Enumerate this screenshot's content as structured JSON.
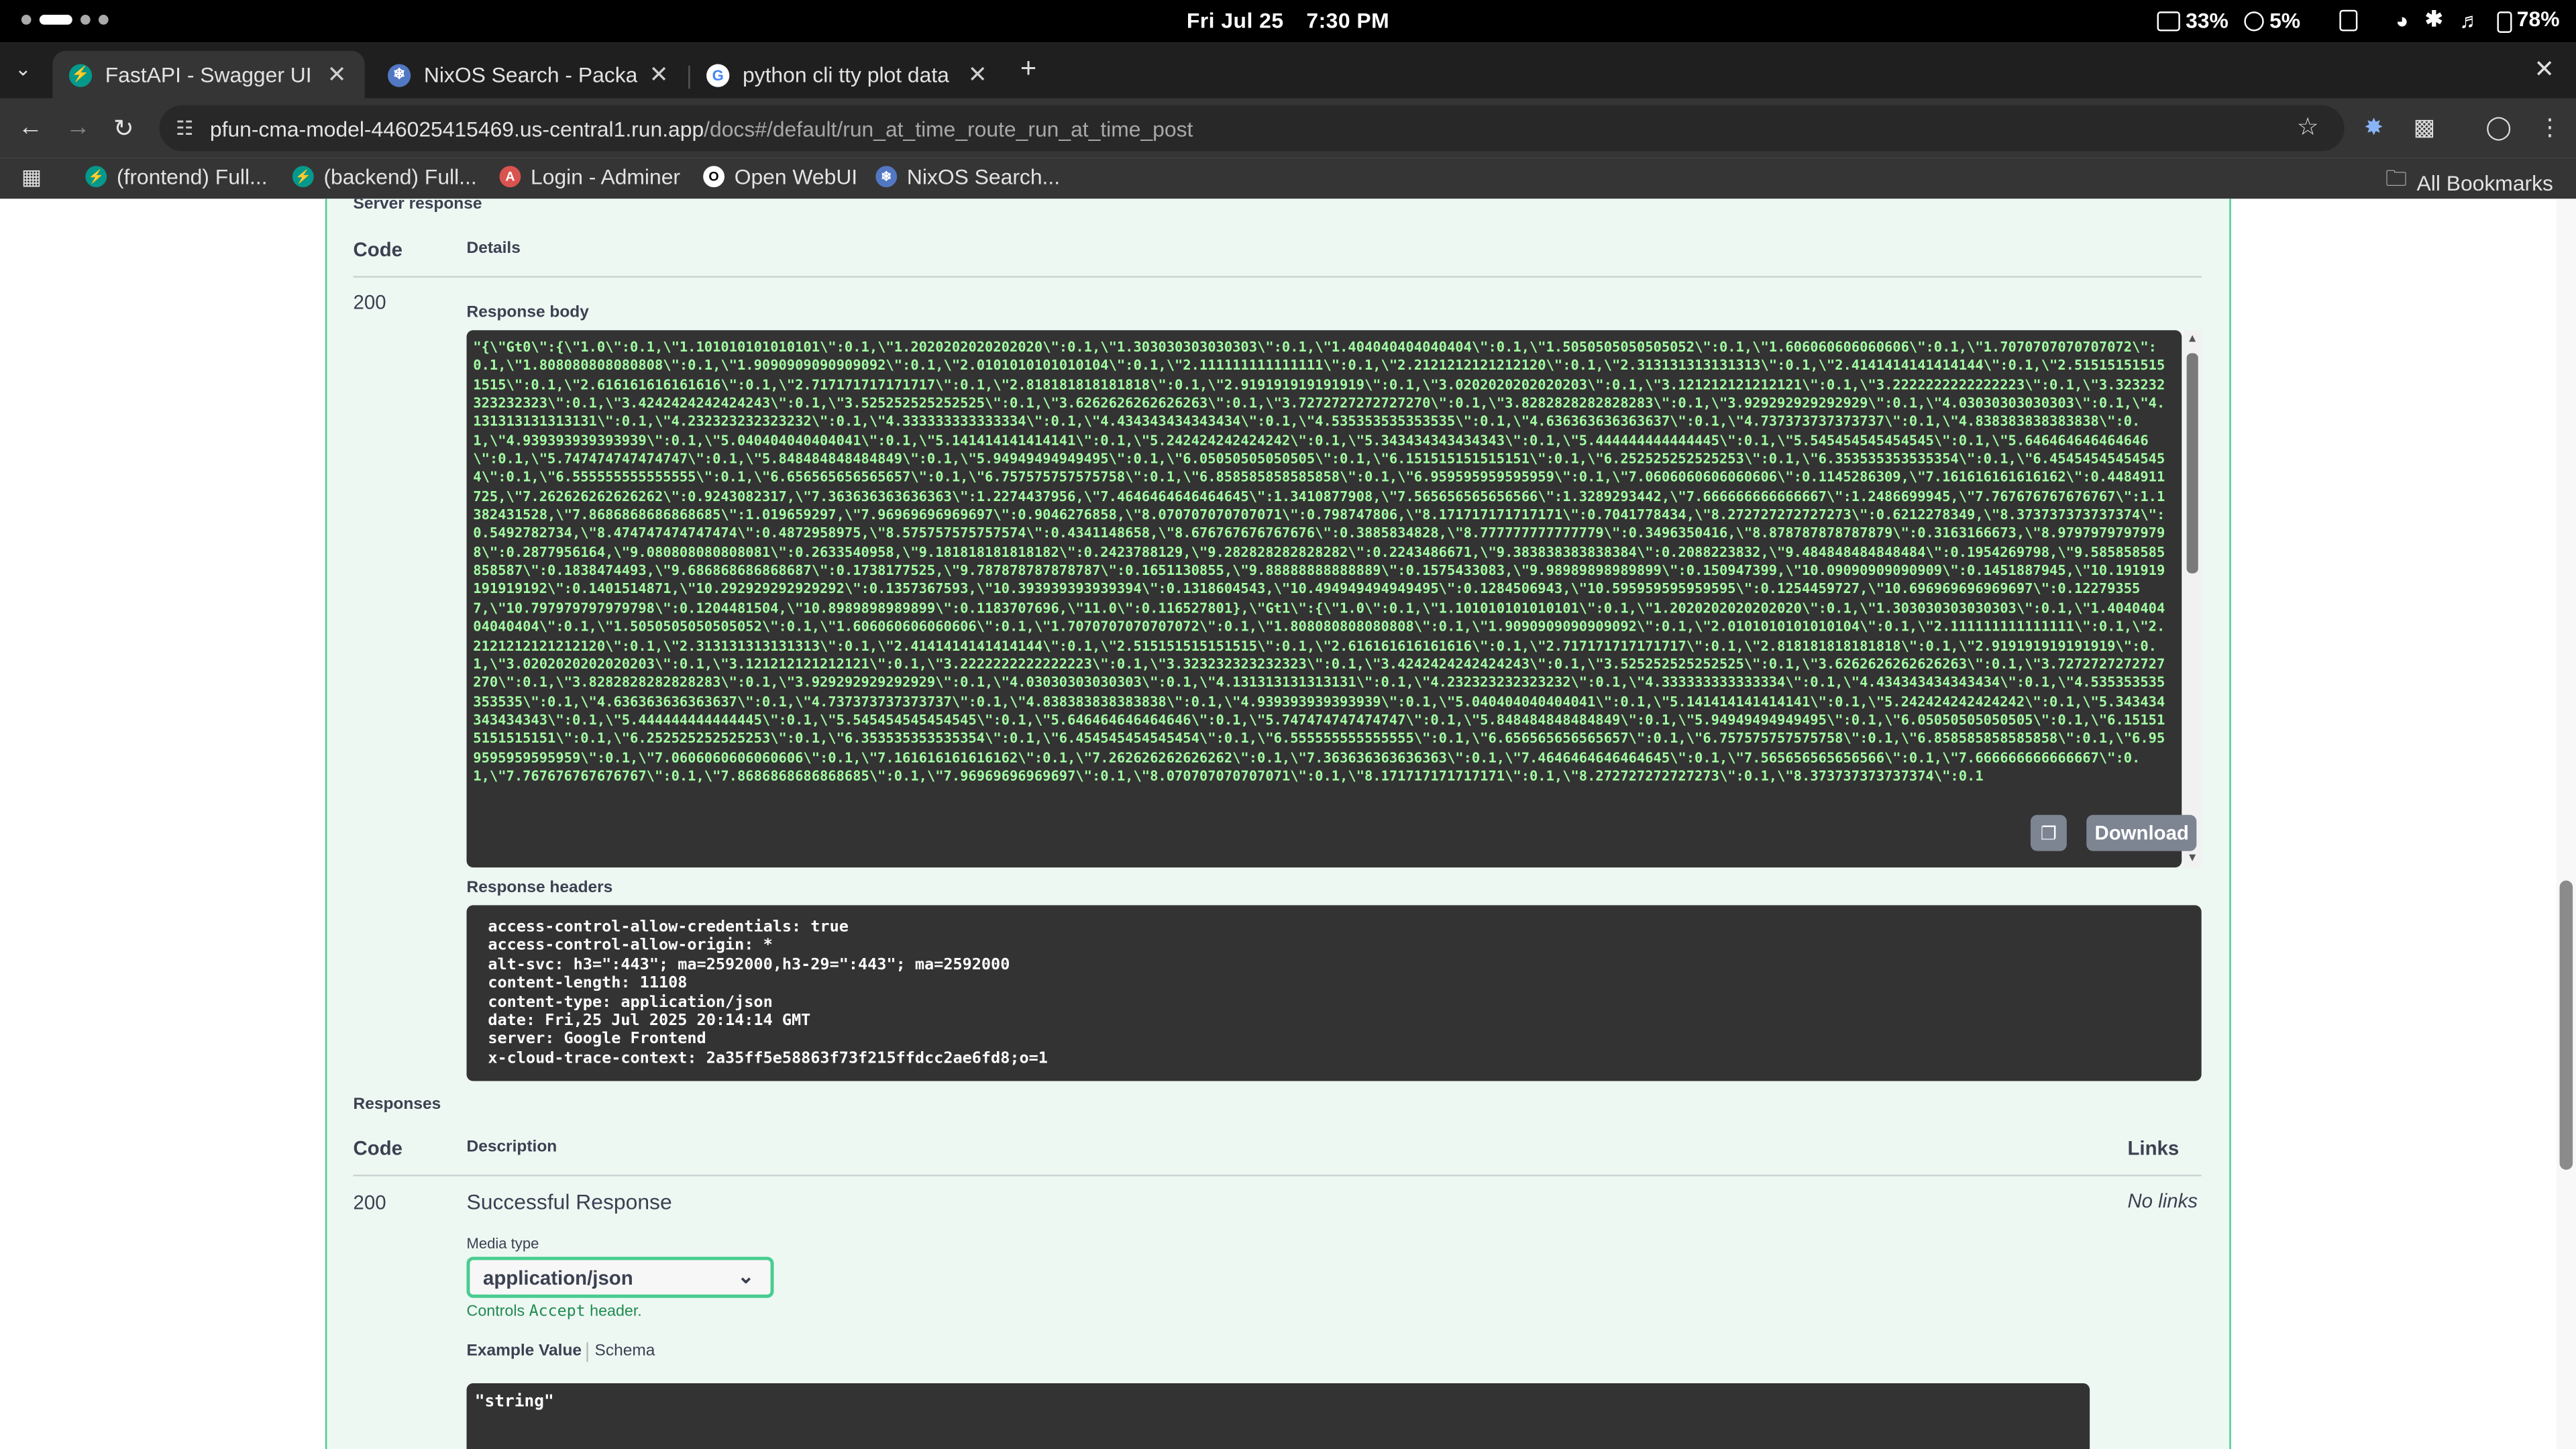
{
  "system": {
    "date": "Fri Jul 25",
    "time": "7:30 PM",
    "keyboard_battery": "33%",
    "stylus_battery": "5%",
    "battery": "78%"
  },
  "tabs": [
    {
      "title": "FastAPI - Swagger UI",
      "icon": "fastapi-icon",
      "color": "#05998b",
      "active": true
    },
    {
      "title": "NixOS Search - Packag",
      "icon": "nixos-icon",
      "color": "#7eb8df",
      "active": false
    },
    {
      "title": "python cli tty plot data",
      "icon": "google-icon",
      "color": "#4285f4",
      "active": false
    }
  ],
  "address": {
    "host": "pfun-cma-model-446025415469.us-central1.run.app",
    "path": "/docs#/default/run_at_time_route_run_at_time_post"
  },
  "bookmarks": [
    {
      "label": "(frontend) Full...",
      "icon": "fastapi-icon",
      "color": "#05998b"
    },
    {
      "label": "(backend) Full...",
      "icon": "fastapi-icon",
      "color": "#05998b"
    },
    {
      "label": "Login - Adminer",
      "icon": "adminer-icon",
      "color": "#d9534f"
    },
    {
      "label": "Open WebUI",
      "icon": "openwebui-icon",
      "color": "#ffffff"
    },
    {
      "label": "NixOS Search...",
      "icon": "nixos-icon",
      "color": "#7eb8df"
    }
  ],
  "all_bookmarks": "All Bookmarks",
  "server_response": {
    "section_title": "Server response",
    "col_code": "Code",
    "col_details": "Details",
    "code": "200",
    "body_label": "Response body",
    "body": "\"{\\\"Gt0\\\":{\\\"1.0\\\":0.1,\\\"1.101010101010101\\\":0.1,\\\"1.2020202020202020\\\":0.1,\\\"1.303030303030303\\\":0.1,\\\"1.404040404040404\\\":0.1,\\\"1.5050505050505052\\\":0.1,\\\"1.606060606060606\\\":0.1,\\\"1.7070707070707072\\\":0.1,\\\"1.808080808080808\\\":0.1,\\\"1.9090909090909092\\\":0.1,\\\"2.0101010101010104\\\":0.1,\\\"2.111111111111111\\\":0.1,\\\"2.2121212121212120\\\":0.1,\\\"2.313131313131313\\\":0.1,\\\"2.4141414141414144\\\":0.1,\\\"2.515151515151515\\\":0.1,\\\"2.616161616161616\\\":0.1,\\\"2.717171717171717\\\":0.1,\\\"2.818181818181818\\\":0.1,\\\"2.919191919191919\\\":0.1,\\\"3.0202020202020203\\\":0.1,\\\"3.121212121212121\\\":0.1,\\\"3.2222222222222223\\\":0.1,\\\"3.323232323232323\\\":0.1,\\\"3.4242424242424243\\\":0.1,\\\"3.525252525252525\\\":0.1,\\\"3.6262626262626263\\\":0.1,\\\"3.7272727272727270\\\":0.1,\\\"3.8282828282828283\\\":0.1,\\\"3.929292929292929\\\":0.1,\\\"4.03030303030303\\\":0.1,\\\"4.131313131313131\\\":0.1,\\\"4.232323232323232\\\":0.1,\\\"4.333333333333334\\\":0.1,\\\"4.434343434343434\\\":0.1,\\\"4.535353535353535\\\":0.1,\\\"4.636363636363637\\\":0.1,\\\"4.737373737373737\\\":0.1,\\\"4.838383838383838\\\":0.1,\\\"4.939393939393939\\\":0.1,\\\"5.040404040404041\\\":0.1,\\\"5.141414141414141\\\":0.1,\\\"5.242424242424242\\\":0.1,\\\"5.343434343434343\\\":0.1,\\\"5.444444444444445\\\":0.1,\\\"5.545454545454545\\\":0.1,\\\"5.646464646464646\\\":0.1,\\\"5.747474747474747\\\":0.1,\\\"5.848484848484849\\\":0.1,\\\"5.94949494949495\\\":0.1,\\\"6.05050505050505\\\":0.1,\\\"6.151515151515151\\\":0.1,\\\"6.252525252525253\\\":0.1,\\\"6.353535353535354\\\":0.1,\\\"6.454545454545454\\\":0.1,\\\"6.555555555555555\\\":0.1,\\\"6.656565656565657\\\":0.1,\\\"6.757575757575758\\\":0.1,\\\"6.858585858585858\\\":0.1,\\\"6.959595959595959\\\":0.1,\\\"7.0606060606060606\\\":0.1145286309,\\\"7.161616161616162\\\":0.4484911725,\\\"7.262626262626262\\\":0.9243082317,\\\"7.363636363636363\\\":1.2274437956,\\\"7.4646464646464645\\\":1.3410877908,\\\"7.565656565656566\\\":1.3289293442,\\\"7.666666666666667\\\":1.2486699945,\\\"7.767676767676767\\\":1.1382431528,\\\"7.8686868686868685\\\":1.019659297,\\\"7.96969696969697\\\":0.9046276858,\\\"8.070707070707071\\\":0.798747806,\\\"8.171717171717171\\\":0.7041778434,\\\"8.272727272727273\\\":0.6212278349,\\\"8.373737373737374\\\":0.5492782734,\\\"8.474747474747474\\\":0.4872958975,\\\"8.575757575757574\\\":0.4341148658,\\\"8.676767676767676\\\":0.3885834828,\\\"8.777777777777779\\\":0.3496350416,\\\"8.878787878787879\\\":0.3163166673,\\\"8.97979797979798\\\":0.2877956164,\\\"9.080808080808081\\\":0.2633540958,\\\"9.181818181818182\\\":0.2423788129,\\\"9.282828282828282\\\":0.2243486671,\\\"9.383838383838384\\\":0.2088223832,\\\"9.484848484848484\\\":0.1954269798,\\\"9.585858585858587\\\":0.1838474493,\\\"9.686868686868687\\\":0.1738177525,\\\"9.787878787878787\\\":0.1651130855,\\\"9.88888888888889\\\":0.1575433083,\\\"9.98989898989899\\\":0.150947399,\\\"10.09090909090909\\\":0.1451887945,\\\"10.191919191919192\\\":0.1401514871,\\\"10.292929292929292\\\":0.1357367593,\\\"10.393939393939394\\\":0.1318604543,\\\"10.494949494949495\\\":0.1284506943,\\\"10.595959595959595\\\":0.1254459727,\\\"10.696969696969697\\\":0.122793557,\\\"10.797979797979798\\\":0.1204481504,\\\"10.8989898989899\\\":0.1183707696,\\\"11.0\\\":0.116527801},\\\"Gt1\\\":{\\\"1.0\\\":0.1,\\\"1.101010101010101\\\":0.1,\\\"1.2020202020202020\\\":0.1,\\\"1.303030303030303\\\":0.1,\\\"1.404040404040404\\\":0.1,\\\"1.5050505050505052\\\":0.1,\\\"1.606060606060606\\\":0.1,\\\"1.7070707070707072\\\":0.1,\\\"1.808080808080808\\\":0.1,\\\"1.9090909090909092\\\":0.1,\\\"2.0101010101010104\\\":0.1,\\\"2.111111111111111\\\":0.1,\\\"2.2121212121212120\\\":0.1,\\\"2.313131313131313\\\":0.1,\\\"2.4141414141414144\\\":0.1,\\\"2.515151515151515\\\":0.1,\\\"2.616161616161616\\\":0.1,\\\"2.717171717171717\\\":0.1,\\\"2.818181818181818\\\":0.1,\\\"2.919191919191919\\\":0.1,\\\"3.0202020202020203\\\":0.1,\\\"3.121212121212121\\\":0.1,\\\"3.2222222222222223\\\":0.1,\\\"3.323232323232323\\\":0.1,\\\"3.4242424242424243\\\":0.1,\\\"3.525252525252525\\\":0.1,\\\"3.6262626262626263\\\":0.1,\\\"3.7272727272727270\\\":0.1,\\\"3.8282828282828283\\\":0.1,\\\"3.929292929292929\\\":0.1,\\\"4.03030303030303\\\":0.1,\\\"4.131313131313131\\\":0.1,\\\"4.232323232323232\\\":0.1,\\\"4.333333333333334\\\":0.1,\\\"4.434343434343434\\\":0.1,\\\"4.535353535353535\\\":0.1,\\\"4.636363636363637\\\":0.1,\\\"4.737373737373737\\\":0.1,\\\"4.838383838383838\\\":0.1,\\\"4.939393939393939\\\":0.1,\\\"5.040404040404041\\\":0.1,\\\"5.141414141414141\\\":0.1,\\\"5.242424242424242\\\":0.1,\\\"5.343434343434343\\\":0.1,\\\"5.444444444444445\\\":0.1,\\\"5.545454545454545\\\":0.1,\\\"5.646464646464646\\\":0.1,\\\"5.747474747474747\\\":0.1,\\\"5.848484848484849\\\":0.1,\\\"5.94949494949495\\\":0.1,\\\"6.05050505050505\\\":0.1,\\\"6.151515151515151\\\":0.1,\\\"6.252525252525253\\\":0.1,\\\"6.353535353535354\\\":0.1,\\\"6.454545454545454\\\":0.1,\\\"6.555555555555555\\\":0.1,\\\"6.656565656565657\\\":0.1,\\\"6.757575757575758\\\":0.1,\\\"6.858585858585858\\\":0.1,\\\"6.959595959595959\\\":0.1,\\\"7.0606060606060606\\\":0.1,\\\"7.161616161616162\\\":0.1,\\\"7.262626262626262\\\":0.1,\\\"7.363636363636363\\\":0.1,\\\"7.4646464646464645\\\":0.1,\\\"7.565656565656566\\\":0.1,\\\"7.666666666666667\\\":0.1,\\\"7.767676767676767\\\":0.1,\\\"7.8686868686868685\\\":0.1,\\\"7.96969696969697\\\":0.1,\\\"8.070707070707071\\\":0.1,\\\"8.171717171717171\\\":0.1,\\\"8.272727272727273\\\":0.1,\\\"8.373737373737374\\\":0.1",
    "download_label": "Download",
    "headers_label": "Response headers",
    "headers": [
      "access-control-allow-credentials: true",
      "access-control-allow-origin: *",
      "alt-svc: h3=\":443\"; ma=2592000,h3-29=\":443\"; ma=2592000",
      "content-length: 11108",
      "content-type: application/json",
      "date: Fri,25 Jul 2025 20:14:14 GMT",
      "server: Google Frontend",
      "x-cloud-trace-context: 2a35ff5e58863f73f215ffdcc2ae6fd8;o=1"
    ]
  },
  "responses": {
    "title": "Responses",
    "col_code": "Code",
    "col_description": "Description",
    "col_links": "Links",
    "code": "200",
    "description": "Successful Response",
    "links": "No links",
    "media_type_label": "Media type",
    "media_type": "application/json",
    "controls_note_pre": "Controls ",
    "controls_note_code": "Accept",
    "controls_note_post": " header.",
    "example_tab": "Example Value",
    "schema_tab": "Schema",
    "example_value": "\"string\""
  }
}
